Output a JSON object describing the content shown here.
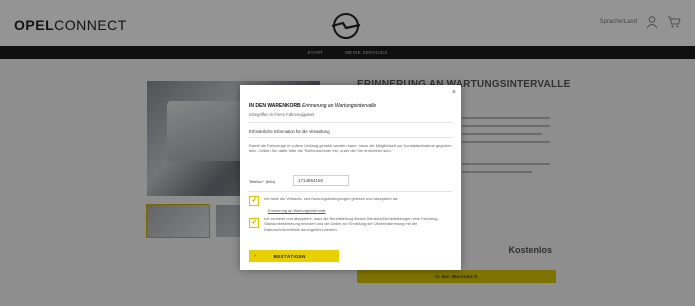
{
  "header": {
    "logo_bold": "OPEL",
    "logo_light": "CONNECT",
    "right_link": "Sprache/Land",
    "icons": [
      "user-icon",
      "cart-icon"
    ]
  },
  "navbar": {
    "items": [
      "Start",
      "Meine Services"
    ]
  },
  "background": {
    "product_title": "ERINNERUNG AN WARTUNGSINTERVALLE",
    "price": "Kostenlos",
    "cart_button": "In den Warenkorb"
  },
  "modal": {
    "close": "×",
    "title_bold": "IN DEN WARENKORB",
    "title_italic": "Erinnerung an Wartungsintervalle",
    "subtitle": "Inbegriffen in Ihrem Fahrzeugpaket",
    "section_title": "Erforderliche Information für die Verwaltung",
    "paragraph": "Damit die Fahrzeuge in vollem Umfang genutzt werden kann, muss die Möglichkeit zur Kontaktaufnahme gegeben sein. Geben Sie dafür bitte die Telefonnummer ein, unter der Sie erreichbar sind.",
    "vin_label": "Telefon",
    "vin_required": "*",
    "vin_suffix": "(Info)",
    "vin_value": "1714854150",
    "checkbox1_text": "Ich habe die Verkaufs- und Nutzungsbedingungen gelesen und akzeptiere sie",
    "checkbox1_link": "Erinnerung an Wartungsintervalle",
    "checkbox2_text": "Ich verstehe und akzeptiere, dass die Bereitstellung dieses Dienstes/Dienstleistungen eine Fahrzeug-Standortbestimmung erfordert und die Daten zur Ermittlung der Übereinstimmung mit der Datenschutzrichtlinie durchgeführt werden.",
    "confirm_arrow": "›",
    "confirm_label": "BESTÄTIGEN"
  },
  "colors": {
    "accent": "#e6d000",
    "navbar": "#1d1d1d",
    "overlay": "rgba(0,0,0,0.42)"
  }
}
